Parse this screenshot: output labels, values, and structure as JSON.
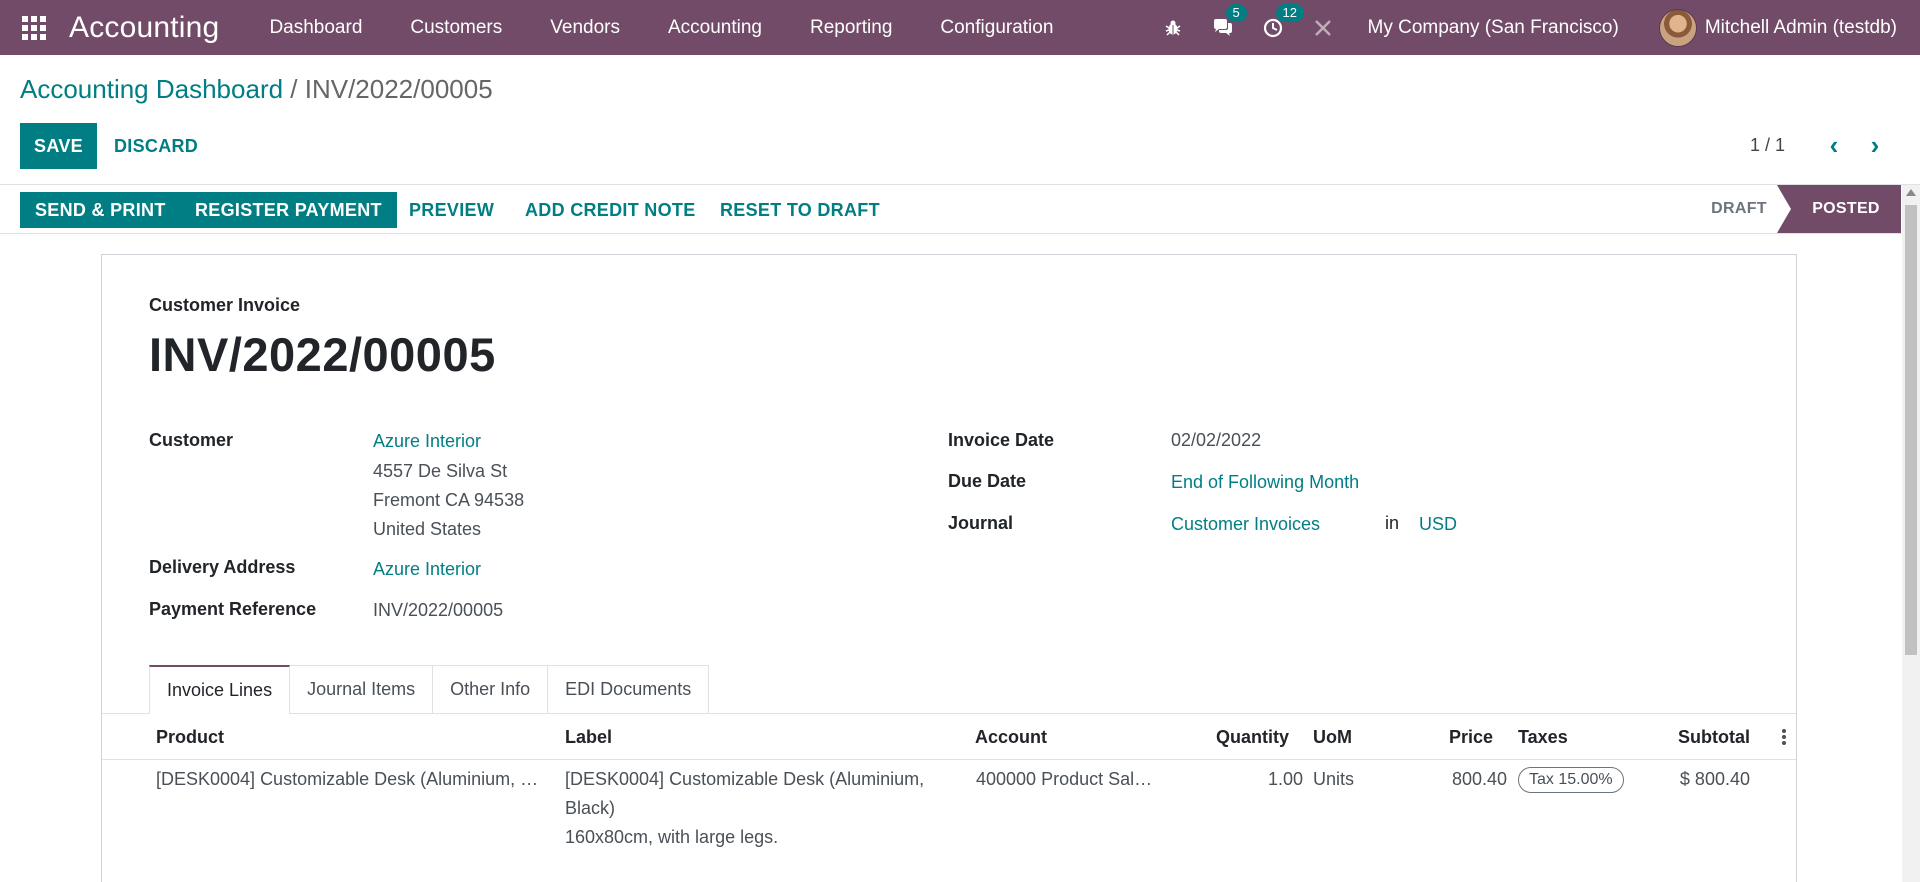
{
  "navbar": {
    "app_name": "Accounting",
    "menu": [
      "Dashboard",
      "Customers",
      "Vendors",
      "Accounting",
      "Reporting",
      "Configuration"
    ],
    "chat_badge": "5",
    "activity_badge": "12",
    "company": "My Company (San Francisco)",
    "user": "Mitchell Admin (testdb)"
  },
  "breadcrumb": {
    "parent": "Accounting Dashboard",
    "separator": " / ",
    "current": "INV/2022/00005"
  },
  "control": {
    "save_label": "SAVE",
    "discard_label": "DISCARD",
    "pager": "1 / 1"
  },
  "statusbar": {
    "buttons": [
      "SEND & PRINT",
      "REGISTER PAYMENT",
      "PREVIEW",
      "ADD CREDIT NOTE",
      "RESET TO DRAFT"
    ],
    "stages": [
      "DRAFT",
      "POSTED"
    ],
    "active_stage": "POSTED"
  },
  "invoice": {
    "type_label": "Customer Invoice",
    "name": "INV/2022/00005",
    "customer_label": "Customer",
    "customer": "Azure Interior",
    "address": [
      "4557 De Silva St",
      "Fremont CA 94538",
      "United States"
    ],
    "delivery_label": "Delivery Address",
    "delivery": "Azure Interior",
    "payment_ref_label": "Payment Reference",
    "payment_ref": "INV/2022/00005",
    "invoice_date_label": "Invoice Date",
    "invoice_date": "02/02/2022",
    "due_date_label": "Due Date",
    "due_date": "End of Following Month",
    "journal_label": "Journal",
    "journal": "Customer Invoices",
    "in_label": "in",
    "currency": "USD"
  },
  "tabs": [
    "Invoice Lines",
    "Journal Items",
    "Other Info",
    "EDI Documents"
  ],
  "lines_table": {
    "columns": [
      "Product",
      "Label",
      "Account",
      "Quantity",
      "UoM",
      "Price",
      "Taxes",
      "Subtotal"
    ],
    "rows": [
      {
        "product": "[DESK0004] Customizable Desk (Aluminium, …",
        "label": [
          "[DESK0004] Customizable Desk (Aluminium,",
          "Black)",
          "160x80cm, with large legs."
        ],
        "account": "400000 Product Sal…",
        "quantity": "1.00",
        "uom": "Units",
        "price": "800.40",
        "tax": "Tax 15.00%",
        "subtotal": "$ 800.40"
      }
    ]
  },
  "colors": {
    "brand": "#714b67",
    "accent": "#017e84"
  }
}
